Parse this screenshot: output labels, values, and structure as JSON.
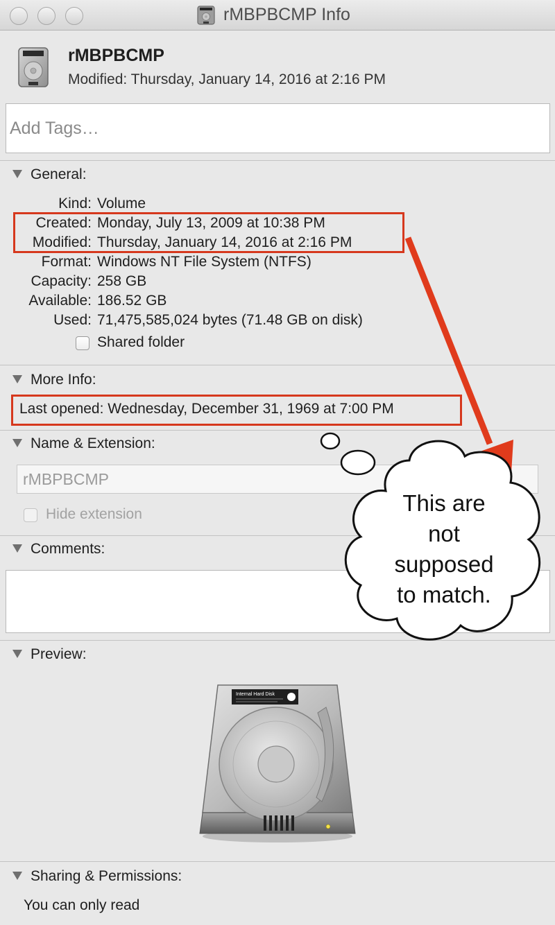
{
  "window": {
    "title": "rMBPBCMP Info",
    "traffic_lights": [
      "close-button",
      "minimize-button",
      "zoom-button"
    ]
  },
  "header": {
    "name": "rMBPBCMP",
    "modified": "Modified: Thursday, January 14, 2016 at 2:16 PM",
    "icon": "hard-disk-icon"
  },
  "tags": {
    "placeholder": "Add Tags…"
  },
  "general": {
    "title": "General:",
    "rows": [
      {
        "label": "Kind:",
        "value": "Volume"
      },
      {
        "label": "Created:",
        "value": "Monday, July 13, 2009 at 10:38 PM"
      },
      {
        "label": "Modified:",
        "value": "Thursday, January 14, 2016 at 2:16 PM"
      },
      {
        "label": "Format:",
        "value": "Windows NT File System (NTFS)"
      },
      {
        "label": "Capacity:",
        "value": "258 GB"
      },
      {
        "label": "Available:",
        "value": "186.52 GB"
      },
      {
        "label": "Used:",
        "value": "71,475,585,024 bytes (71.48 GB on disk)"
      }
    ],
    "shared_folder": {
      "label": "Shared folder",
      "checked": false
    }
  },
  "more_info": {
    "title": "More Info:",
    "last_opened": "Last opened: Wednesday, December 31, 1969 at 7:00 PM"
  },
  "name_extension": {
    "title": "Name & Extension:",
    "name_value": "rMBPBCMP",
    "hide_extension": {
      "label": "Hide extension",
      "checked": false,
      "enabled": false
    }
  },
  "comments": {
    "title": "Comments:",
    "value": ""
  },
  "preview": {
    "title": "Preview:",
    "icon": "internal-hard-disk-icon",
    "disk_label": "Internal Hard Disk"
  },
  "sharing": {
    "title": "Sharing & Permissions:",
    "status": "You can only read"
  },
  "annotation": {
    "callout_lines": [
      "This are",
      "not",
      "supposed",
      "to match."
    ],
    "highlight_color": "#d6381d"
  }
}
